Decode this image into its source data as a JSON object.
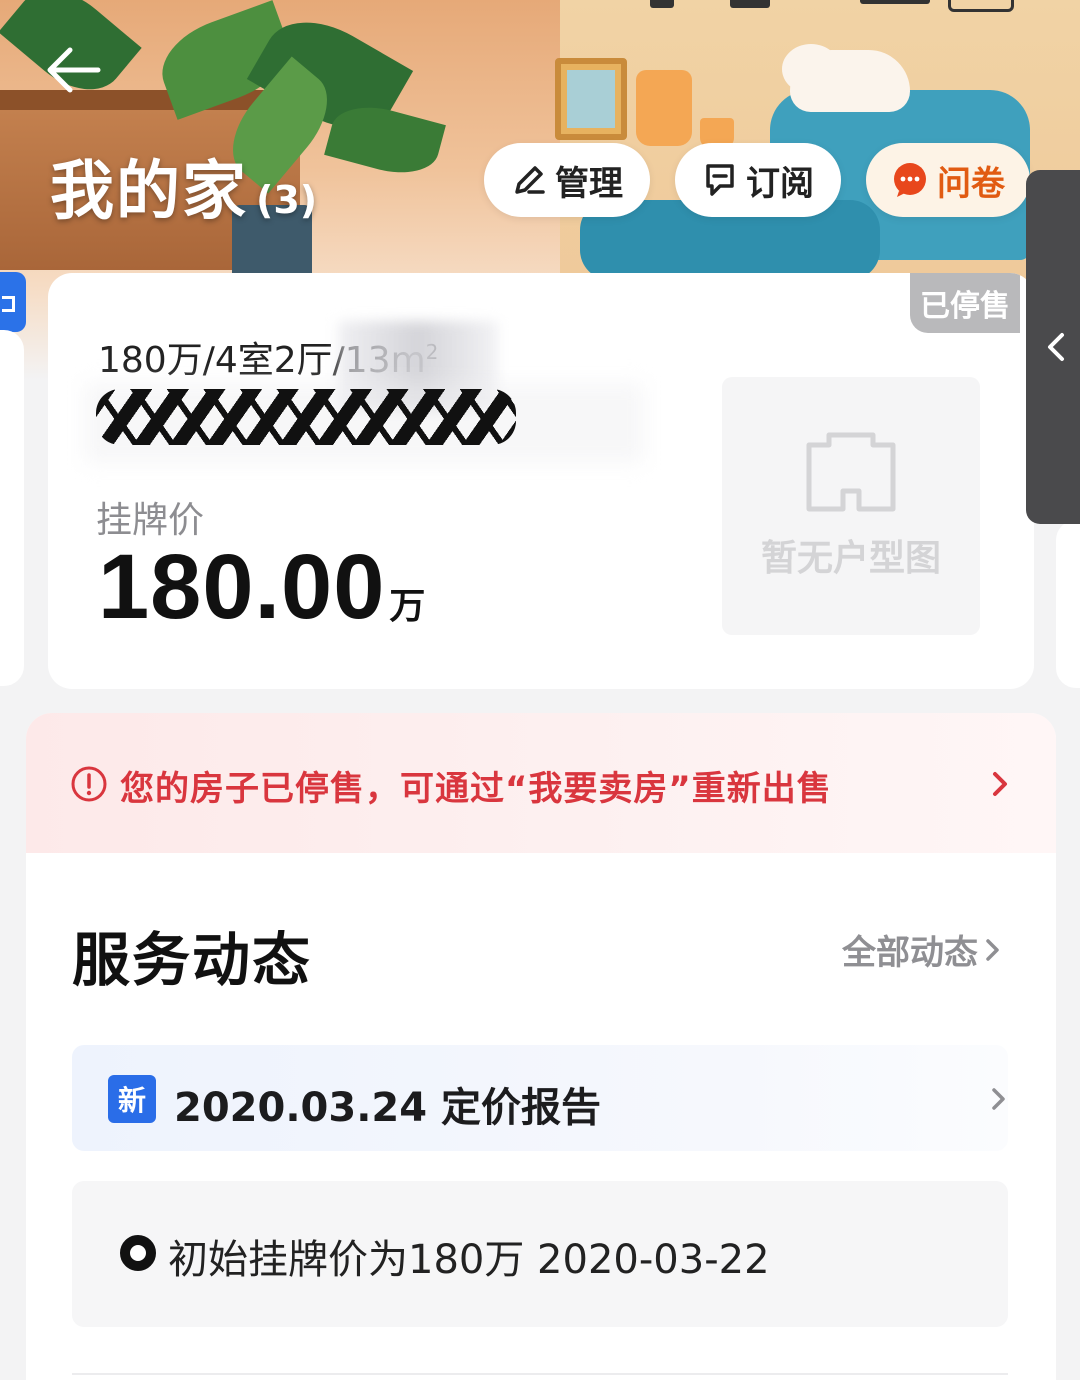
{
  "header": {
    "title": "我的家",
    "count": "(3)",
    "buttons": {
      "manage": "管理",
      "subscribe": "订阅",
      "survey": "问卷"
    }
  },
  "house": {
    "status_badge": "已停售",
    "summary": "180万/4室2厅/1",
    "summary_tail": "3m",
    "summary_sup": "2",
    "price_label": "挂牌价",
    "price_value": "180.00",
    "price_unit": "万",
    "floorplan_placeholder": "暂无户型图"
  },
  "alert": {
    "text": "您的房子已停售，可通过“我要卖房”重新出售"
  },
  "service": {
    "title": "服务动态",
    "view_all": "全部动态",
    "report": {
      "badge": "新",
      "text": "2020.03.24 定价报告"
    },
    "events": [
      {
        "text": "初始挂牌价为180万 2020-03-22"
      }
    ]
  },
  "colors": {
    "accent_blue": "#2a6de8",
    "alert_red": "#d9363e",
    "survey_orange": "#e15b12",
    "badge_gray": "#b9b9bb"
  },
  "icons": {
    "back": "arrow-left-icon",
    "manage": "pencil-icon",
    "subscribe": "bookmark-icon",
    "survey": "chat-bubble-icon",
    "alert": "exclamation-circle-icon",
    "chevron": "chevron-right-icon",
    "side_panel": "chevron-left-icon",
    "floorplan": "floorplan-outline-icon",
    "timeline": "timeline-dot-icon"
  }
}
